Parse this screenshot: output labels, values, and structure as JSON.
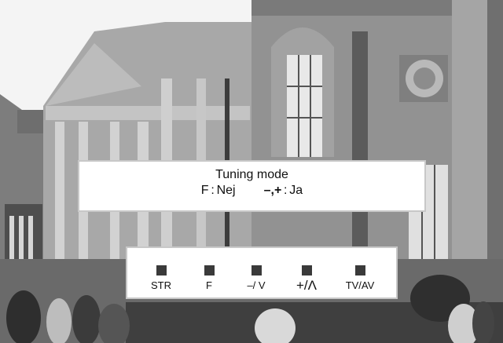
{
  "osd": {
    "title": "Tuning mode",
    "option_f_key": "F",
    "option_f_value": "Nej",
    "option_mp_key": "–,+",
    "option_mp_value": "Ja",
    "separator": ":"
  },
  "buttons": [
    {
      "label": "STR"
    },
    {
      "label": "F"
    },
    {
      "label": "–/ V"
    },
    {
      "label": "+/Λ"
    },
    {
      "label": "TV/AV"
    }
  ],
  "colors": {
    "panel_bg": "#ffffff",
    "button_square": "#3a3a3a"
  }
}
